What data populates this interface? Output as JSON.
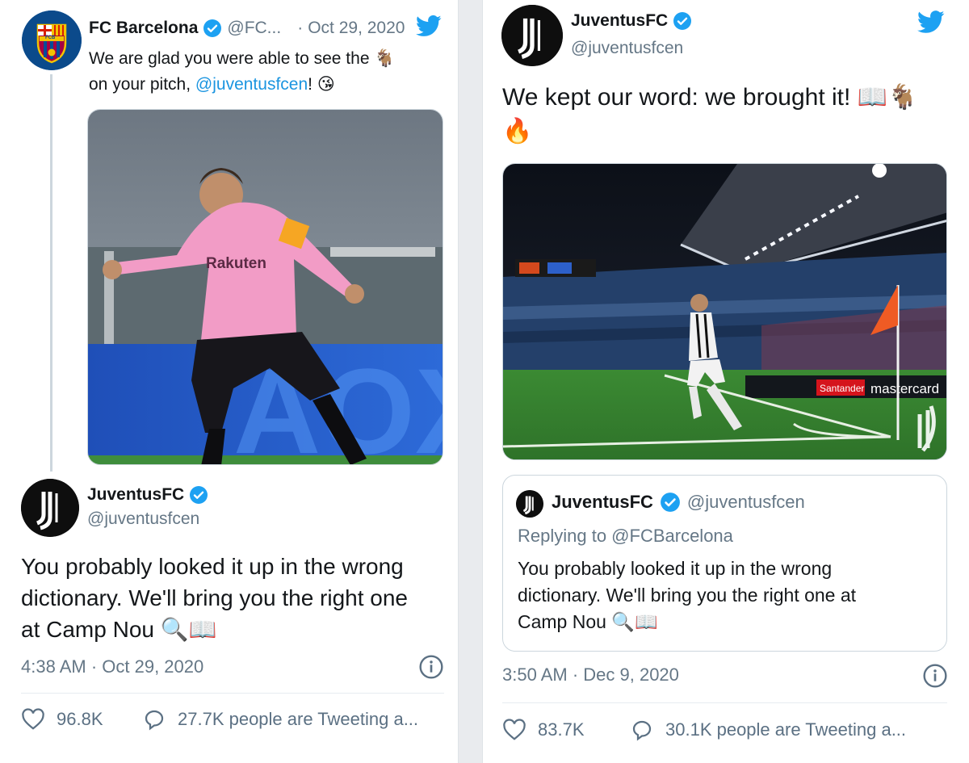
{
  "left": {
    "original": {
      "name": "FC Barcelona",
      "handle": "@FC...",
      "separator": "·",
      "date": "Oct 29, 2020",
      "text_line1": "We are glad you were able to see the",
      "text_line2_prefix": "on your pitch, ",
      "mention": "@juventusfcen",
      "text_line2_suffix": "!",
      "goat_emoji": "🐐",
      "kiss_emoji": "😘",
      "crest_text": "FCB"
    },
    "reply": {
      "name": "JuventusFC",
      "handle": "@juventusfcen",
      "text_line1": "You probably looked it up in the wrong",
      "text_line2": "dictionary. We'll bring you the right one",
      "text_line3": "at Camp Nou",
      "emojis": "🔍📖",
      "timestamp": "4:38 AM · Oct 29, 2020",
      "likes": "96.8K",
      "tweeting": "27.7K people are Tweeting a..."
    },
    "media": {
      "sponsor": "Rakuten"
    }
  },
  "right": {
    "tweet": {
      "name": "JuventusFC",
      "handle": "@juventusfcen",
      "text_line1": "We kept our word: we brought it!",
      "line1_emojis": "📖🐐",
      "line2_emoji": "🔥",
      "timestamp": "3:50 AM · Dec 9, 2020",
      "likes": "83.7K",
      "tweeting": "30.1K people are Tweeting a..."
    },
    "quote": {
      "name": "JuventusFC",
      "handle": "@juventusfcen",
      "replying": "Replying to @FCBarcelona",
      "text_line1": "You probably looked it up in the wrong",
      "text_line2": "dictionary. We'll bring you the right one at",
      "text_line3": "Camp Nou",
      "emojis": "🔍📖"
    },
    "media": {
      "board1": "Santander",
      "board2": "mastercard"
    }
  },
  "colors": {
    "twitter_blue": "#1da1f2",
    "link": "#1b95e0",
    "muted": "#657786",
    "barca_blue": "#004d98",
    "barca_red": "#a50044"
  }
}
